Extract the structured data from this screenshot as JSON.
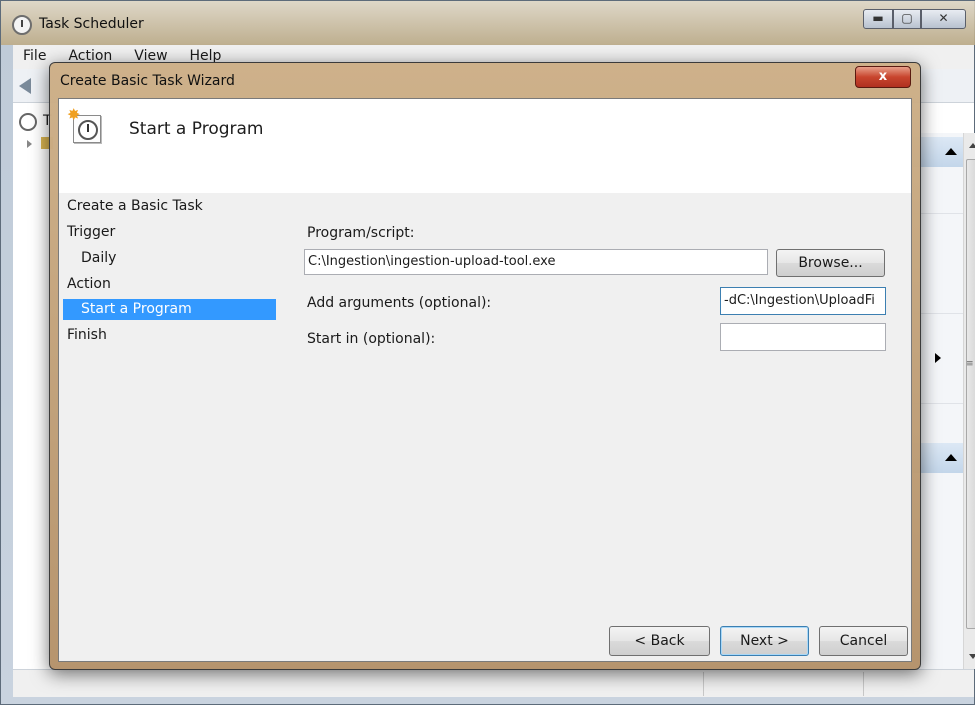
{
  "background_window": {
    "title": "Task Scheduler",
    "menu": [
      "File",
      "Action",
      "View",
      "Help"
    ],
    "tree_label": "T",
    "window_buttons": {
      "minimize": "▬",
      "maximize": "▢",
      "close": "✕"
    }
  },
  "wizard": {
    "title": "Create Basic Task Wizard",
    "close_glyph": "x",
    "header_title": "Start a Program",
    "nav": [
      {
        "label": "Create a Basic Task",
        "sub": false,
        "selected": false
      },
      {
        "label": "Trigger",
        "sub": false,
        "selected": false
      },
      {
        "label": "Daily",
        "sub": true,
        "selected": false
      },
      {
        "label": "Action",
        "sub": false,
        "selected": false
      },
      {
        "label": "Start a Program",
        "sub": true,
        "selected": true
      },
      {
        "label": "Finish",
        "sub": false,
        "selected": false
      }
    ],
    "form": {
      "program_label": "Program/script:",
      "program_value": "C:\\Ingestion\\ingestion-upload-tool.exe",
      "browse_label": "Browse...",
      "arguments_label": "Add arguments (optional):",
      "arguments_value": "-dC:\\Ingestion\\UploadFi",
      "start_in_label": "Start in (optional):",
      "start_in_value": ""
    },
    "buttons": {
      "back": "< Back",
      "next": "Next >",
      "cancel": "Cancel"
    }
  }
}
